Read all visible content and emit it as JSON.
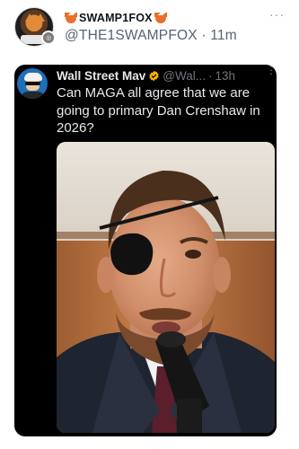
{
  "author": {
    "display_name": "SWAMP1FOX",
    "handle": "@THE1SWAMPFOX",
    "separator": "·",
    "time": "11m",
    "more_label": "···",
    "emoji_icon": "fox-face-icon",
    "avatar_icon": "fox-avatar",
    "avatar_badge": "◎"
  },
  "quoted": {
    "display_name": "Wall Street Mav",
    "verified": true,
    "verified_color": "#f4b400",
    "handle": "@Wal...",
    "separator": "·",
    "time": "13h",
    "text": "Can MAGA all agree that we are going to primary Dan Crenshaw in 2026?",
    "more_label": "⋮",
    "image_alt": "Photo of a man with an eye patch speaking into a microphone",
    "image_icon": "photo-image"
  },
  "colors": {
    "background": "#ffffff",
    "card_background": "#000000",
    "primary_text_dark": "#0f1419",
    "secondary_text": "#536471",
    "card_text": "#e7e9ea",
    "card_secondary_text": "#71767b"
  }
}
